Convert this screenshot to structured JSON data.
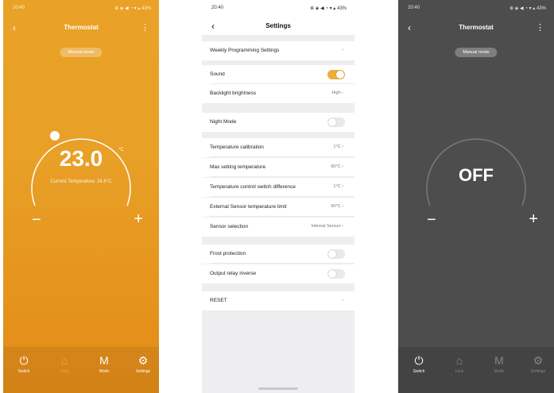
{
  "screen1": {
    "status_time": "20:40",
    "status_right": "⊕ ◈ ◀ ◔ ▾ ▴ 43%",
    "title": "Thermostat",
    "mode_label": "Manual mode",
    "temperature": "23.0",
    "unit": "°C",
    "current_temp": "Current Temperature: 24.8°C",
    "minus": "−",
    "plus": "+",
    "tabs": [
      {
        "label": "Switch",
        "icon": "power-icon"
      },
      {
        "label": "Lock",
        "icon": "lock-icon"
      },
      {
        "label": "Mode",
        "icon": "mode-icon"
      },
      {
        "label": "Settings",
        "icon": "gear-icon"
      }
    ],
    "colors": {
      "background": "#e9a227",
      "ring": "#ffffff"
    }
  },
  "screen2": {
    "status_time": "20:40",
    "status_right": "⊕ ◈ ◀ ◔ ▾ ▴ 43%",
    "title": "Settings",
    "rows": [
      {
        "label": "Weekly Programming Settings",
        "value": ""
      },
      {
        "label": "Sound",
        "toggle": true
      },
      {
        "label": "Backlight brightness",
        "value": "High"
      },
      {
        "label": "Night Mode",
        "toggle": false
      },
      {
        "label": "Temperature calibration",
        "value": "1°C"
      },
      {
        "label": "Max setting temperature",
        "value": "60°C"
      },
      {
        "label": "Temperature control switch difference",
        "value": "1°C"
      },
      {
        "label": "External Sensor temperature limit",
        "value": "60°C"
      },
      {
        "label": "Sensor selection",
        "value": "Internal Sensor"
      },
      {
        "label": "Frost protection",
        "toggle": false
      },
      {
        "label": "Output relay inverse",
        "toggle": false
      },
      {
        "label": "RESET",
        "value": ""
      }
    ],
    "colors": {
      "toggle_on": "#eeae3a"
    }
  },
  "screen3": {
    "status_time": "20:40",
    "status_right": "⊕ ◈ ◀ ◔ ▾ ▴ 43%",
    "title": "Thermostat",
    "mode_label": "Manual mode",
    "state": "OFF",
    "minus": "−",
    "plus": "+",
    "tabs": [
      {
        "label": "Switch",
        "icon": "power-icon"
      },
      {
        "label": "Lock",
        "icon": "lock-icon"
      },
      {
        "label": "Mode",
        "icon": "mode-icon"
      },
      {
        "label": "Settings",
        "icon": "gear-icon"
      }
    ],
    "colors": {
      "background": "#4d4d4d"
    }
  }
}
